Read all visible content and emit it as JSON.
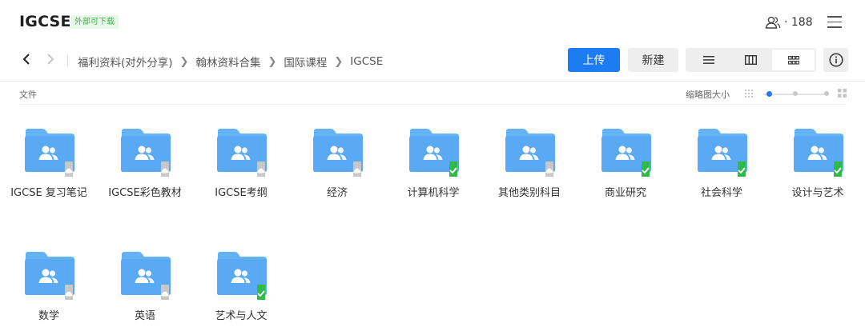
{
  "header": {
    "title": "IGCSE",
    "badge": "外部可下载",
    "member_count": "· 188"
  },
  "nav": {
    "back_icon": "chevron-left-icon",
    "forward_icon": "chevron-right-icon",
    "breadcrumbs": [
      "福利资料(对外分享)",
      "翰林资料合集",
      "国际课程",
      "IGCSE"
    ]
  },
  "toolbar": {
    "upload_label": "上传",
    "new_label": "新建",
    "views": [
      "list-view-icon",
      "column-view-icon",
      "grid-view-icon"
    ],
    "active_view": "grid-view-icon",
    "info_icon": "info-icon"
  },
  "section": {
    "label": "文件",
    "thumb_size_label": "缩略图大小",
    "thumb_size_level": 0.05
  },
  "colors": {
    "accent": "#1e7cf2",
    "folder": "#5aa9f4",
    "synced": "#2fba4a",
    "cloud": "#c8c8c8"
  },
  "folders": [
    {
      "name": "IGCSE 复习笔记",
      "status": "cloud"
    },
    {
      "name": "IGCSE彩色教材",
      "status": "cloud"
    },
    {
      "name": "IGCSE考纲",
      "status": "cloud"
    },
    {
      "name": "经济",
      "status": "cloud"
    },
    {
      "name": "计算机科学",
      "status": "check"
    },
    {
      "name": "其他类别科目",
      "status": "cloud"
    },
    {
      "name": "商业研究",
      "status": "check"
    },
    {
      "name": "社会科学",
      "status": "check"
    },
    {
      "name": "设计与艺术",
      "status": "check"
    },
    {
      "name": "数学",
      "status": "cloud"
    },
    {
      "name": "英语",
      "status": "cloud"
    },
    {
      "name": "艺术与人文",
      "status": "check"
    }
  ]
}
